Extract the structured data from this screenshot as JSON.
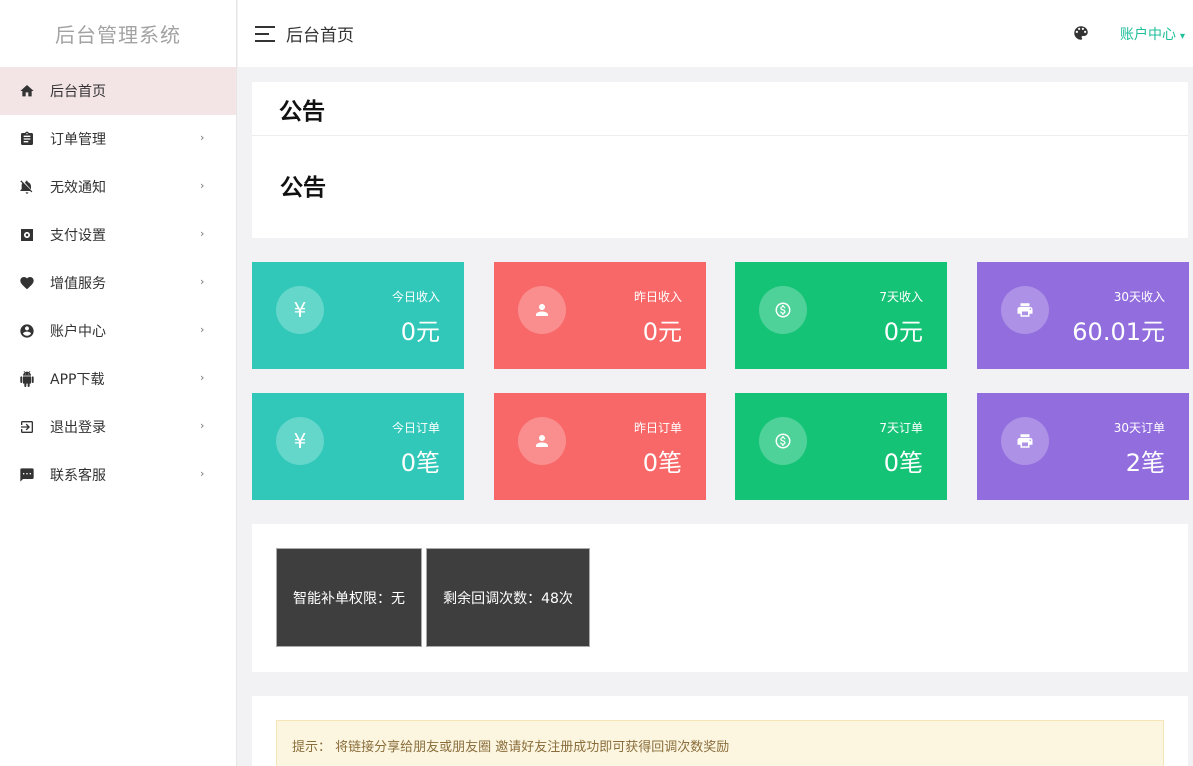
{
  "brand": "后台管理系统",
  "sidebar": {
    "items": [
      {
        "label": "后台首页"
      },
      {
        "label": "订单管理"
      },
      {
        "label": "无效通知"
      },
      {
        "label": "支付设置"
      },
      {
        "label": "增值服务"
      },
      {
        "label": "账户中心"
      },
      {
        "label": "APP下载"
      },
      {
        "label": "退出登录"
      },
      {
        "label": "联系客服"
      }
    ],
    "arrow": "›"
  },
  "header": {
    "title": "后台首页",
    "account_label": "账户中心",
    "account_caret": "▾"
  },
  "notice": {
    "heading": "公告",
    "body": "公告"
  },
  "stats": [
    {
      "icon": "¥",
      "label": "今日收入",
      "value": "0元",
      "color": "#31c8b9"
    },
    {
      "icon": "user",
      "label": "昨日收入",
      "value": "0元",
      "color": "#f86868"
    },
    {
      "icon": "coin",
      "label": "7天收入",
      "value": "0元",
      "color": "#15c377"
    },
    {
      "icon": "printer",
      "label": "30天收入",
      "value": "60.01元",
      "color": "#926dde"
    },
    {
      "icon": "¥",
      "label": "今日订单",
      "value": "0笔",
      "color": "#31c8b9"
    },
    {
      "icon": "user",
      "label": "昨日订单",
      "value": "0笔",
      "color": "#f86868"
    },
    {
      "icon": "coin",
      "label": "7天订单",
      "value": "0笔",
      "color": "#15c377"
    },
    {
      "icon": "printer",
      "label": "30天订单",
      "value": "2笔",
      "color": "#926dde"
    }
  ],
  "permissions": {
    "smart_refill": "智能补单权限：无",
    "callbacks_left": "剩余回调次数：48次"
  },
  "tip": "提示：   将链接分享给朋友或朋友圈 邀请好友注册成功即可获得回调次数奖励"
}
